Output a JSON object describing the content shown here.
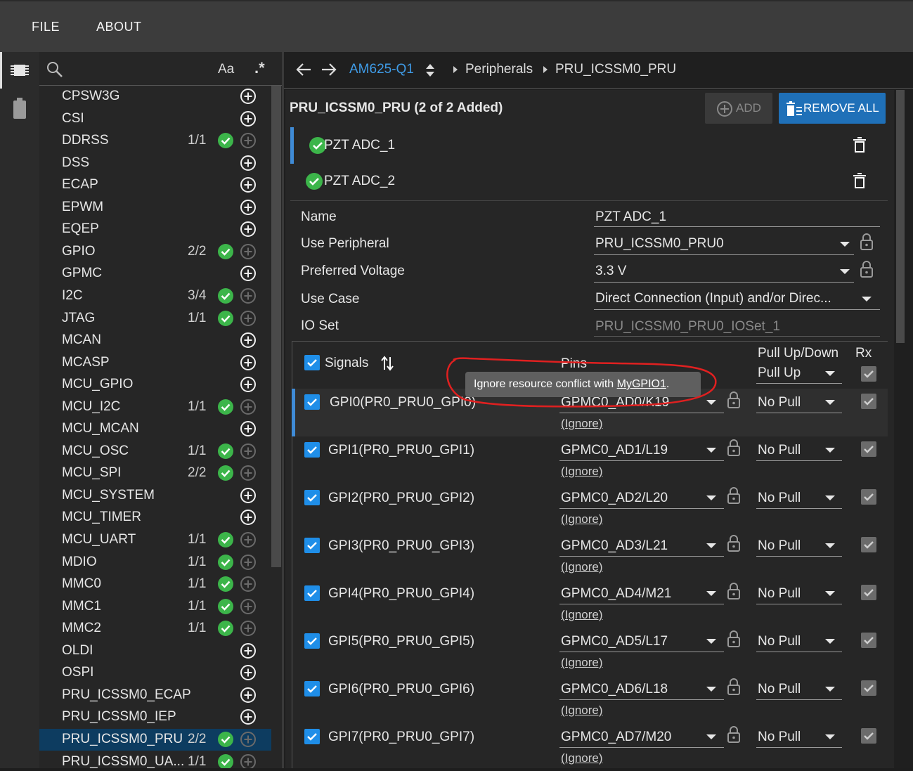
{
  "menu": {
    "file": "FILE",
    "about": "ABOUT"
  },
  "search": {
    "placeholder": "",
    "case_toggle": "Aa",
    "regex_toggle": ".*"
  },
  "sidebar": {
    "items": [
      {
        "label": "CPSW3G",
        "count": "",
        "added": false
      },
      {
        "label": "CSI",
        "count": "",
        "added": false
      },
      {
        "label": "DDRSS",
        "count": "1/1",
        "added": true
      },
      {
        "label": "DSS",
        "count": "",
        "added": false
      },
      {
        "label": "ECAP",
        "count": "",
        "added": false
      },
      {
        "label": "EPWM",
        "count": "",
        "added": false
      },
      {
        "label": "EQEP",
        "count": "",
        "added": false
      },
      {
        "label": "GPIO",
        "count": "2/2",
        "added": true
      },
      {
        "label": "GPMC",
        "count": "",
        "added": false
      },
      {
        "label": "I2C",
        "count": "3/4",
        "added": true
      },
      {
        "label": "JTAG",
        "count": "1/1",
        "added": true
      },
      {
        "label": "MCAN",
        "count": "",
        "added": false
      },
      {
        "label": "MCASP",
        "count": "",
        "added": false
      },
      {
        "label": "MCU_GPIO",
        "count": "",
        "added": false
      },
      {
        "label": "MCU_I2C",
        "count": "1/1",
        "added": true
      },
      {
        "label": "MCU_MCAN",
        "count": "",
        "added": false
      },
      {
        "label": "MCU_OSC",
        "count": "1/1",
        "added": true
      },
      {
        "label": "MCU_SPI",
        "count": "2/2",
        "added": true
      },
      {
        "label": "MCU_SYSTEM",
        "count": "",
        "added": false
      },
      {
        "label": "MCU_TIMER",
        "count": "",
        "added": false
      },
      {
        "label": "MCU_UART",
        "count": "1/1",
        "added": true
      },
      {
        "label": "MDIO",
        "count": "1/1",
        "added": true
      },
      {
        "label": "MMC0",
        "count": "1/1",
        "added": true
      },
      {
        "label": "MMC1",
        "count": "1/1",
        "added": true
      },
      {
        "label": "MMC2",
        "count": "1/1",
        "added": true
      },
      {
        "label": "OLDI",
        "count": "",
        "added": false
      },
      {
        "label": "OSPI",
        "count": "",
        "added": false
      },
      {
        "label": "PRU_ICSSM0_ECAP",
        "count": "",
        "added": false
      },
      {
        "label": "PRU_ICSSM0_IEP",
        "count": "",
        "added": false
      },
      {
        "label": "PRU_ICSSM0_PRU",
        "count": "2/2",
        "added": true,
        "selected": true
      },
      {
        "label": "PRU_ICSSM0_UA...",
        "count": "1/1",
        "added": true
      }
    ]
  },
  "breadcrumb": {
    "device": "AM625-Q1",
    "section": "Peripherals",
    "current": "PRU_ICSSM0_PRU"
  },
  "panel": {
    "title": "PRU_ICSSM0_PRU (2 of 2 Added)",
    "add_label": "ADD",
    "remove_all_label": "REMOVE ALL",
    "instances": [
      "PZT ADC_1",
      "PZT ADC_2"
    ]
  },
  "fields": {
    "name_label": "Name",
    "name_value": "PZT ADC_1",
    "peripheral_label": "Use Peripheral",
    "peripheral_value": "PRU_ICSSM0_PRU0",
    "voltage_label": "Preferred Voltage",
    "voltage_value": "3.3 V",
    "usecase_label": "Use Case",
    "usecase_value": "Direct Connection (Input) and/or Direc...",
    "ioset_label": "IO Set",
    "ioset_value": "PRU_ICSSM0_PRU0_IOSet_1"
  },
  "table": {
    "signals_header": "Signals",
    "pins_header": "Pins",
    "pull_header": "Pull Up/Down",
    "pull_header_value": "Pull Up",
    "rx_header": "Rx",
    "ignore_label": "(Ignore)",
    "rows": [
      {
        "signal": "GPI0(PR0_PRU0_GPI0)",
        "pin": "GPMC0_AD0/K19",
        "pull": "No Pull"
      },
      {
        "signal": "GPI1(PR0_PRU0_GPI1)",
        "pin": "GPMC0_AD1/L19",
        "pull": "No Pull"
      },
      {
        "signal": "GPI2(PR0_PRU0_GPI2)",
        "pin": "GPMC0_AD2/L20",
        "pull": "No Pull"
      },
      {
        "signal": "GPI3(PR0_PRU0_GPI3)",
        "pin": "GPMC0_AD3/L21",
        "pull": "No Pull"
      },
      {
        "signal": "GPI4(PR0_PRU0_GPI4)",
        "pin": "GPMC0_AD4/M21",
        "pull": "No Pull"
      },
      {
        "signal": "GPI5(PR0_PRU0_GPI5)",
        "pin": "GPMC0_AD5/L17",
        "pull": "No Pull"
      },
      {
        "signal": "GPI6(PR0_PRU0_GPI6)",
        "pin": "GPMC0_AD6/L18",
        "pull": "No Pull"
      },
      {
        "signal": "GPI7(PR0_PRU0_GPI7)",
        "pin": "GPMC0_AD7/M20",
        "pull": "No Pull"
      }
    ]
  },
  "tooltip": {
    "prefix": "Ignore resource conflict with ",
    "link": "MyGPIO1",
    "suffix": "."
  },
  "colors": {
    "accent": "#1f70b8",
    "check_green": "#3cb54a",
    "checkbox_blue": "#1f8ee8",
    "annotation_red": "#e02020"
  }
}
